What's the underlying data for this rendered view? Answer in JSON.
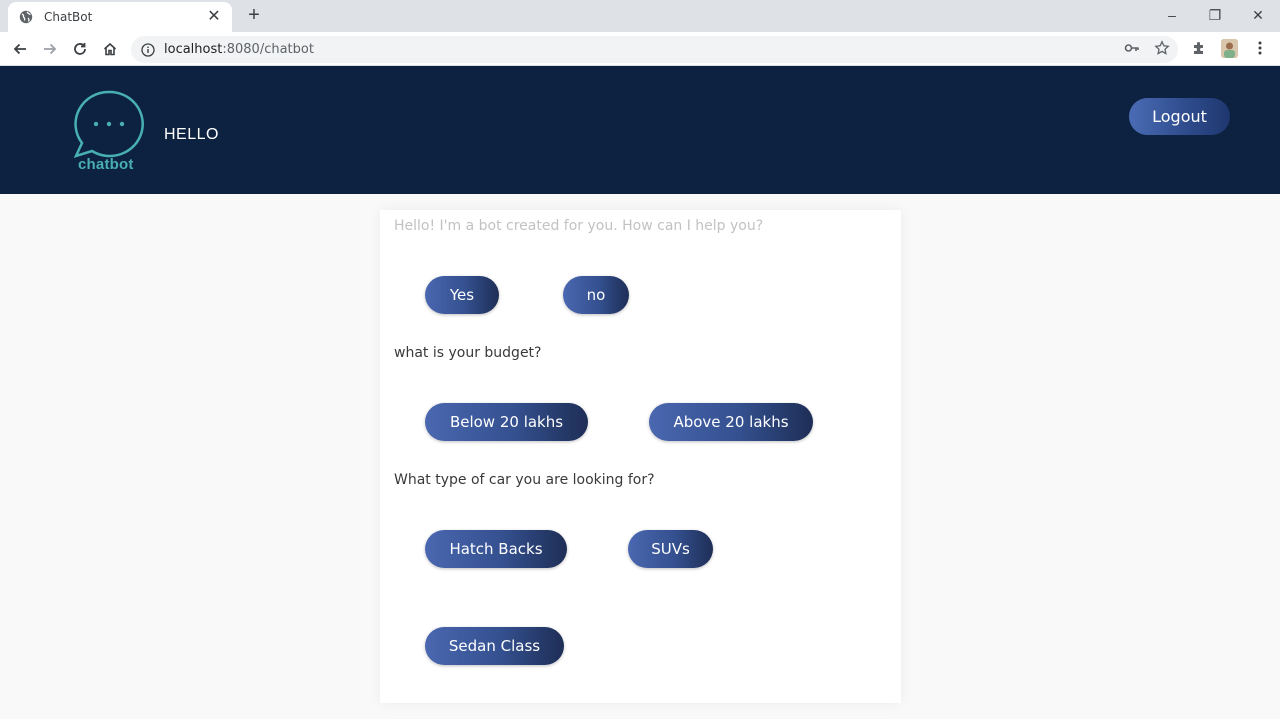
{
  "browser": {
    "tab_title": "ChatBot",
    "tab_close": "✕",
    "new_tab": "+",
    "url_host": "localhost",
    "url_rest": ":8080/chatbot",
    "window_controls": {
      "minimize": "–",
      "restore": "❐",
      "close": "✕"
    }
  },
  "header": {
    "logo_text": "chatbot",
    "greeting": "HELLO",
    "logout_label": "Logout",
    "bg_color": "#0c2240",
    "logo_color": "#48b0b2"
  },
  "chat": {
    "messages": [
      {
        "text": "Hello! I'm a bot created for you. How can I help you?"
      },
      {
        "text": "what is your budget?"
      },
      {
        "text": "What type of car you are looking for?"
      }
    ],
    "options": {
      "yes": "Yes",
      "no": "no",
      "below": "Below 20 lakhs",
      "above": "Above 20 lakhs",
      "hatch": "Hatch Backs",
      "suv": "SUVs",
      "sedan": "Sedan Class"
    },
    "button_gradient": [
      "#4a67b0",
      "#1e2e56"
    ]
  }
}
